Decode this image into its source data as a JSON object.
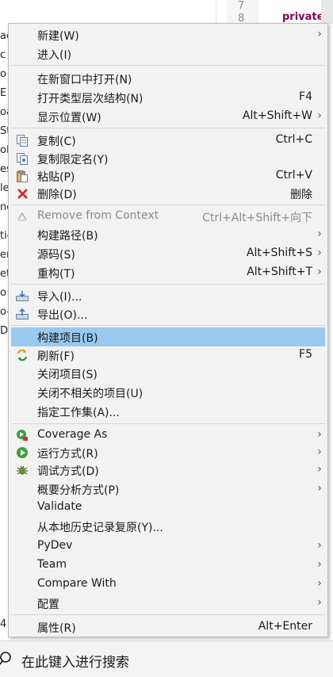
{
  "background": {
    "line_number": "7",
    "line_number_2": "8",
    "code_fragment": "private",
    "left_fragments": [
      "ac",
      "c",
      "o",
      "E",
      "oa",
      "St",
      "oL",
      "es",
      "le",
      "ne",
      "tic",
      "er",
      "et",
      "o",
      "o-",
      "D"
    ],
    "bottom_fragment": "4"
  },
  "menu": {
    "items": [
      {
        "label": "新建(W)",
        "shortcut": "",
        "submenu": true
      },
      {
        "label": "进入(I)",
        "shortcut": "",
        "submenu": false
      },
      {
        "label": "在新窗口中打开(N)",
        "shortcut": "",
        "submenu": false
      },
      {
        "label": "打开类型层次结构(N)",
        "shortcut": "F4",
        "submenu": false
      },
      {
        "label": "显示位置(W)",
        "shortcut": "Alt+Shift+W",
        "submenu": true
      },
      {
        "label": "复制(C)",
        "shortcut": "Ctrl+C",
        "submenu": false,
        "icon": "copy-icon"
      },
      {
        "label": "复制限定名(Y)",
        "shortcut": "",
        "submenu": false,
        "icon": "copy-qualified-icon"
      },
      {
        "label": "粘贴(P)",
        "shortcut": "Ctrl+V",
        "submenu": false,
        "icon": "paste-icon"
      },
      {
        "label": "删除(D)",
        "shortcut": "删除",
        "submenu": false,
        "icon": "delete-icon"
      },
      {
        "label": "Remove from Context",
        "shortcut": "Ctrl+Alt+Shift+向下",
        "submenu": false,
        "disabled": true,
        "icon": "remove-context-icon"
      },
      {
        "label": "构建路径(B)",
        "shortcut": "",
        "submenu": true
      },
      {
        "label": "源码(S)",
        "shortcut": "Alt+Shift+S",
        "submenu": true
      },
      {
        "label": "重构(T)",
        "shortcut": "Alt+Shift+T",
        "submenu": true
      },
      {
        "label": "导入(I)...",
        "shortcut": "",
        "submenu": false,
        "icon": "import-icon"
      },
      {
        "label": "导出(O)...",
        "shortcut": "",
        "submenu": false,
        "icon": "export-icon"
      },
      {
        "label": "构建项目(B)",
        "shortcut": "",
        "submenu": false,
        "selected": true
      },
      {
        "label": "刷新(F)",
        "shortcut": "F5",
        "submenu": false,
        "icon": "refresh-icon"
      },
      {
        "label": "关闭项目(S)",
        "shortcut": "",
        "submenu": false
      },
      {
        "label": "关闭不相关的项目(U)",
        "shortcut": "",
        "submenu": false
      },
      {
        "label": "指定工作集(A)...",
        "shortcut": "",
        "submenu": false
      },
      {
        "label": "Coverage As",
        "shortcut": "",
        "submenu": true,
        "icon": "coverage-icon"
      },
      {
        "label": "运行方式(R)",
        "shortcut": "",
        "submenu": true,
        "icon": "run-icon"
      },
      {
        "label": "调试方式(D)",
        "shortcut": "",
        "submenu": true,
        "icon": "debug-icon"
      },
      {
        "label": "概要分析方式(P)",
        "shortcut": "",
        "submenu": true
      },
      {
        "label": "Validate",
        "shortcut": "",
        "submenu": false
      },
      {
        "label": "从本地历史记录复原(Y)...",
        "shortcut": "",
        "submenu": false
      },
      {
        "label": "PyDev",
        "shortcut": "",
        "submenu": true
      },
      {
        "label": "Team",
        "shortcut": "",
        "submenu": true
      },
      {
        "label": "Compare With",
        "shortcut": "",
        "submenu": true
      },
      {
        "label": "配置",
        "shortcut": "",
        "submenu": true
      },
      {
        "label": "属性(R)",
        "shortcut": "Alt+Enter",
        "submenu": false
      }
    ],
    "arrow": "›"
  },
  "search": {
    "placeholder": "在此键入进行搜索"
  },
  "colors": {
    "menu_bg": "#f2f2f2",
    "selection": "#99c9ef",
    "separator": "#d4d4d4",
    "disabled_text": "#8a8a8a"
  }
}
